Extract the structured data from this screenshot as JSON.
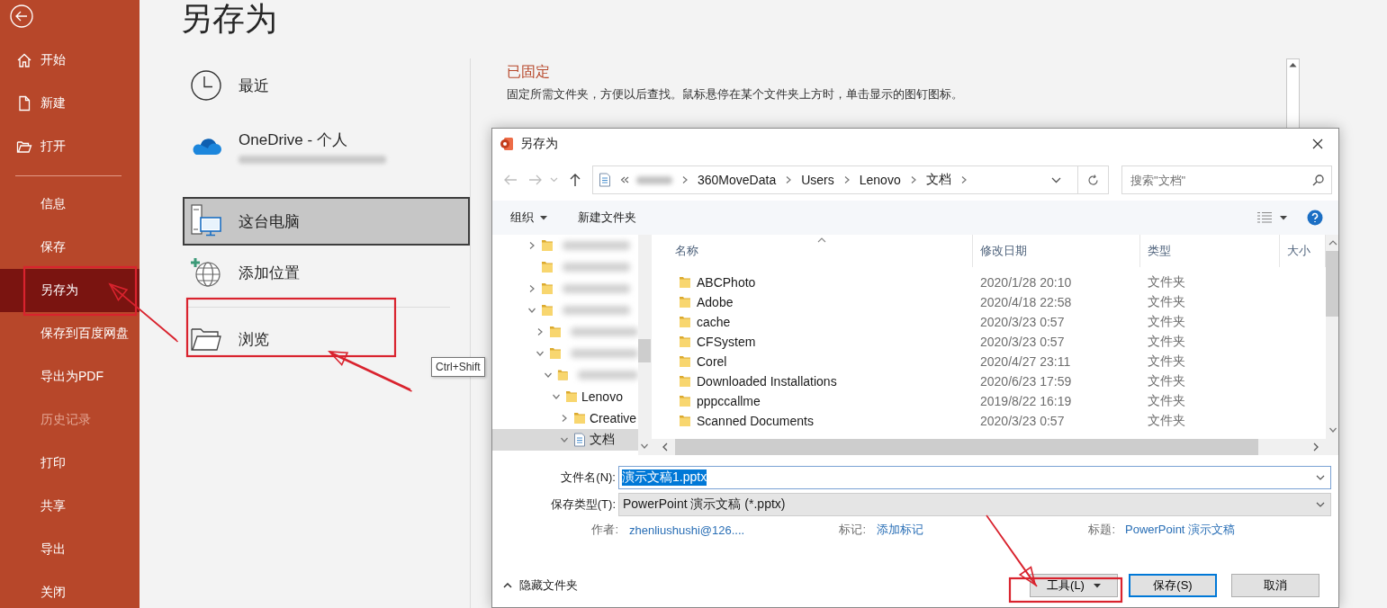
{
  "page_title": "另存为",
  "sidebar": {
    "primary": [
      {
        "label": "开始",
        "kind": "home",
        "selected": false,
        "disabled": false
      },
      {
        "label": "新建",
        "kind": "file",
        "selected": false,
        "disabled": false
      },
      {
        "label": "打开",
        "kind": "folder",
        "selected": false,
        "disabled": false
      }
    ],
    "secondary": [
      {
        "label": "信息",
        "selected": false,
        "disabled": false
      },
      {
        "label": "保存",
        "selected": false,
        "disabled": false
      },
      {
        "label": "另存为",
        "selected": true,
        "disabled": false
      },
      {
        "label": "保存到百度网盘",
        "selected": false,
        "disabled": false
      },
      {
        "label": "导出为PDF",
        "selected": false,
        "disabled": false
      },
      {
        "label": "历史记录",
        "selected": false,
        "disabled": true
      },
      {
        "label": "打印",
        "selected": false,
        "disabled": false
      },
      {
        "label": "共享",
        "selected": false,
        "disabled": false
      },
      {
        "label": "导出",
        "selected": false,
        "disabled": false
      },
      {
        "label": "关闭",
        "selected": false,
        "disabled": false
      }
    ]
  },
  "locations": [
    {
      "label": "最近",
      "kind": "clock",
      "selected": false
    },
    {
      "label": "OneDrive - 个人",
      "kind": "cloud",
      "selected": false
    },
    {
      "label": "这台电脑",
      "kind": "computer",
      "selected": true
    },
    {
      "label": "添加位置",
      "kind": "globe",
      "selected": false
    },
    {
      "label": "浏览",
      "kind": "folder",
      "selected": false
    }
  ],
  "pinned": {
    "heading": "已固定",
    "description": "固定所需文件夹，方便以后查找。鼠标悬停在某个文件夹上方时，单击显示的图钉图标。"
  },
  "tooltip": "Ctrl+Shift",
  "dialog": {
    "title": "另存为",
    "address": [
      "360MoveData",
      "Users",
      "Lenovo",
      "文档"
    ],
    "search": {
      "placeholder": "搜索\"文档\""
    },
    "toolbar": {
      "organize": "组织",
      "new_folder": "新建文件夹"
    },
    "tree": [
      {
        "label": "Lenovo",
        "kind": "folder",
        "expanded": true,
        "selected": false,
        "children": [
          {
            "label": "Creative",
            "kind": "folder",
            "expanded": false,
            "selected": false
          },
          {
            "label": "文档",
            "kind": "library",
            "expanded": true,
            "selected": true
          }
        ]
      }
    ],
    "columns": [
      "名称",
      "修改日期",
      "类型",
      "大小"
    ],
    "rows": [
      {
        "name": "ABCPhoto",
        "date": "2020/1/28 20:10",
        "type": "文件夹",
        "selected": false
      },
      {
        "name": "Adobe",
        "date": "2020/4/18 22:58",
        "type": "文件夹",
        "selected": false
      },
      {
        "name": "cache",
        "date": "2020/3/23 0:57",
        "type": "文件夹",
        "selected": false
      },
      {
        "name": "CFSystem",
        "date": "2020/3/23 0:57",
        "type": "文件夹",
        "selected": false
      },
      {
        "name": "Corel",
        "date": "2020/4/27 23:11",
        "type": "文件夹",
        "selected": false
      },
      {
        "name": "Downloaded Installations",
        "date": "2020/6/23 17:59",
        "type": "文件夹",
        "selected": false
      },
      {
        "name": "pppccallme",
        "date": "2019/8/22 16:19",
        "type": "文件夹",
        "selected": false
      },
      {
        "name": "Scanned Documents",
        "date": "2020/3/23 0:57",
        "type": "文件夹",
        "selected": false
      }
    ],
    "filename": {
      "label": "文件名(N):",
      "value": "演示文稿1.pptx",
      "selected": true
    },
    "file_type": {
      "label": "保存类型(T):",
      "value": "PowerPoint 演示文稿 (*.pptx)"
    },
    "meta": [
      {
        "label": "作者:",
        "value": "zhenliushushi@126...."
      },
      {
        "label": "标记:",
        "value": "添加标记"
      },
      {
        "label": "标题:",
        "value": "PowerPoint 演示文稿"
      }
    ],
    "hide_folders": "隐藏文件夹",
    "buttons": [
      {
        "label": "工具(L)",
        "kind": "menu"
      },
      {
        "label": "保存(S)",
        "kind": "default"
      },
      {
        "label": "取消",
        "kind": "normal"
      }
    ]
  }
}
